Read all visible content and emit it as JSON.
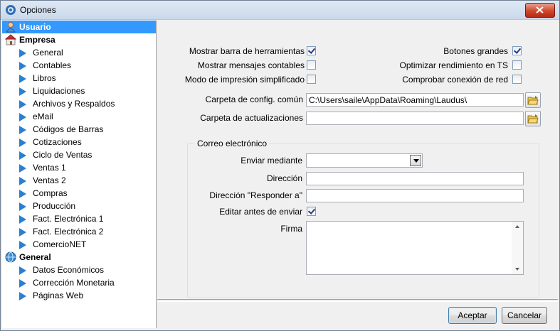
{
  "window": {
    "title": "Opciones"
  },
  "tree": {
    "usuario": "Usuario",
    "empresa": {
      "label": "Empresa",
      "items": [
        "General",
        "Contables",
        "Libros",
        "Liquidaciones",
        "Archivos y Respaldos",
        "eMail",
        "Códigos de Barras",
        "Cotizaciones",
        "Ciclo de Ventas",
        "Ventas 1",
        "Ventas 2",
        "Compras",
        "Producción",
        "Fact. Electrónica 1",
        "Fact. Electrónica 2",
        "ComercioNET"
      ]
    },
    "general": {
      "label": "General",
      "items": [
        "Datos Económicos",
        "Corrección Monetaria",
        "Páginas Web"
      ]
    }
  },
  "options": {
    "mostrar_barra": {
      "label": "Mostrar barra de herramientas",
      "checked": true
    },
    "mostrar_mensajes": {
      "label": "Mostrar mensajes contables",
      "checked": false
    },
    "modo_impresion": {
      "label": "Modo de impresión simplificado",
      "checked": false
    },
    "botones_grandes": {
      "label": "Botones grandes",
      "checked": true
    },
    "optimizar_ts": {
      "label": "Optimizar rendimiento en TS",
      "checked": false
    },
    "comprobar_red": {
      "label": "Comprobar conexión de red",
      "checked": false
    }
  },
  "paths": {
    "config_label": "Carpeta de config. común",
    "config_value": "C:\\Users\\saile\\AppData\\Roaming\\Laudus\\",
    "updates_label": "Carpeta de actualizaciones",
    "updates_value": ""
  },
  "email": {
    "group_title": "Correo electrónico",
    "send_via_label": "Enviar mediante",
    "send_via_value": "",
    "address_label": "Dirección",
    "address_value": "",
    "reply_to_label": "Dirección \"Responder a\"",
    "reply_to_value": "",
    "edit_before_label": "Editar antes de enviar",
    "edit_before_checked": true,
    "signature_label": "Firma",
    "signature_value": ""
  },
  "buttons": {
    "accept": "Aceptar",
    "cancel": "Cancelar"
  },
  "colors": {
    "selection": "#3399ff",
    "arrow": "#2a7fd4",
    "close": "#d0472c"
  }
}
